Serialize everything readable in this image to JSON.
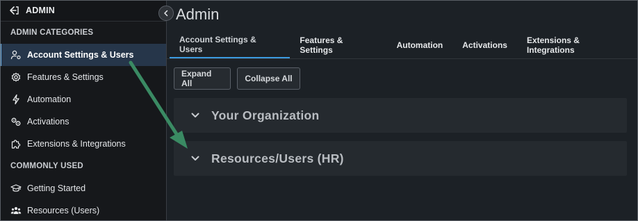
{
  "sidebar": {
    "top_label": "ADMIN",
    "sections": [
      {
        "heading": "ADMIN CATEGORIES",
        "items": [
          {
            "label": "Account Settings & Users",
            "icon": "user-gear-icon",
            "active": true
          },
          {
            "label": "Features & Settings",
            "icon": "gear-icon",
            "active": false
          },
          {
            "label": "Automation",
            "icon": "lightning-bolt-icon",
            "active": false
          },
          {
            "label": "Activations",
            "icon": "toggle-link-icon",
            "active": false
          },
          {
            "label": "Extensions & Integrations",
            "icon": "puzzle-piece-icon",
            "active": false
          }
        ]
      },
      {
        "heading": "COMMONLY USED",
        "items": [
          {
            "label": "Getting Started",
            "icon": "graduation-cap-icon",
            "active": false
          },
          {
            "label": "Resources (Users)",
            "icon": "users-group-icon",
            "active": false
          }
        ]
      }
    ]
  },
  "main": {
    "title": "Admin",
    "tabs": [
      {
        "label": "Account Settings & Users",
        "active": true
      },
      {
        "label": "Features & Settings",
        "active": false
      },
      {
        "label": "Automation",
        "active": false
      },
      {
        "label": "Activations",
        "active": false
      },
      {
        "label": "Extensions & Integrations",
        "active": false
      }
    ],
    "buttons": {
      "expand_all": "Expand All",
      "collapse_all": "Collapse All"
    },
    "panels": [
      {
        "title": "Your Organization"
      },
      {
        "title": "Resources/Users (HR)"
      }
    ]
  },
  "colors": {
    "accent": "#3c9be0",
    "annotation_arrow": "#3a8a63",
    "active_item_bg": "#26364a"
  }
}
